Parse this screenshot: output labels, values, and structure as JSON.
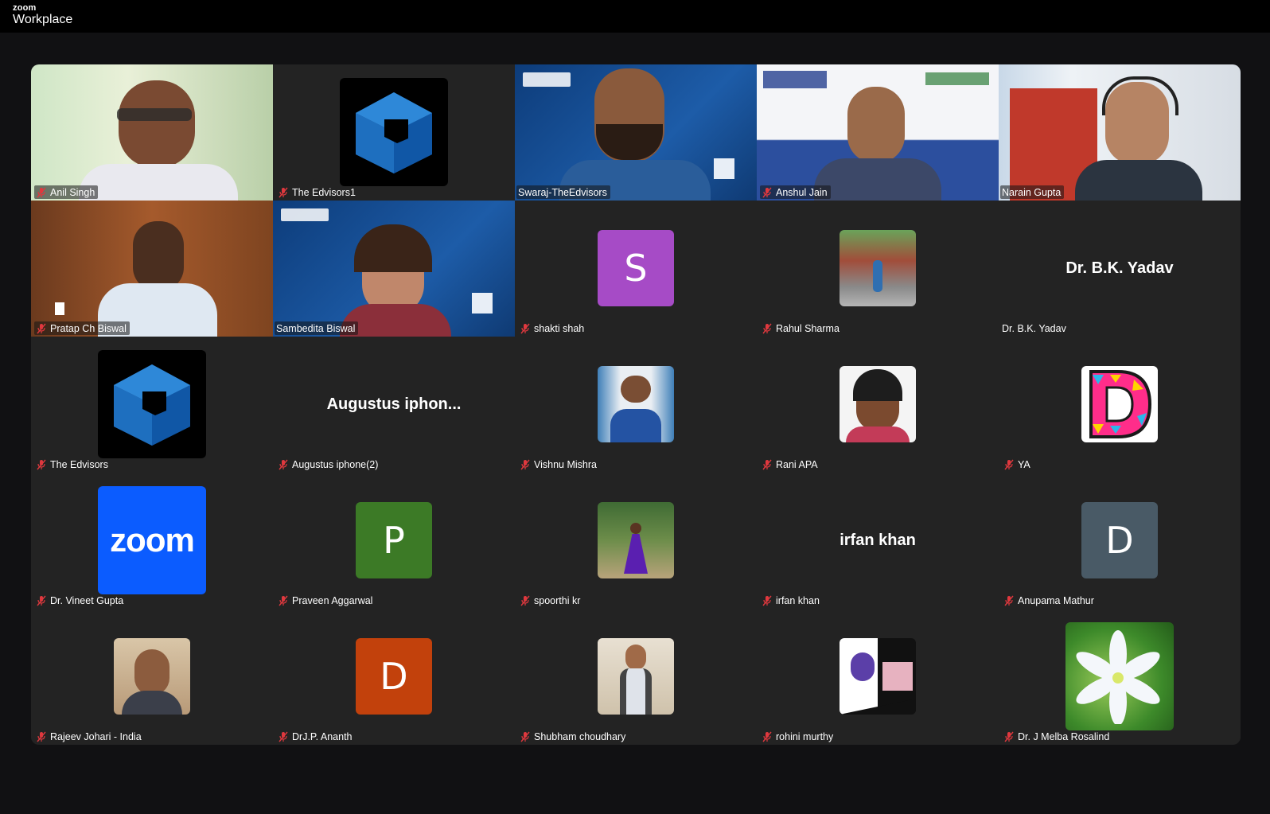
{
  "app": {
    "brand_small": "zoom",
    "brand_name": "Workplace"
  },
  "colors": {
    "active_speaker": "#35d39a",
    "muted_icon": "#e0383e"
  },
  "participants": [
    {
      "name": "Anil Singh",
      "muted": true,
      "kind": "video"
    },
    {
      "name": "The Edvisors1",
      "muted": true,
      "kind": "logo"
    },
    {
      "name": "Swaraj-TheEdvisors",
      "muted": false,
      "kind": "video",
      "active_speaker": true
    },
    {
      "name": "Anshul Jain",
      "muted": true,
      "kind": "video"
    },
    {
      "name": "Narain Gupta",
      "muted": false,
      "kind": "video"
    },
    {
      "name": "Pratap Ch Biswal",
      "muted": true,
      "kind": "video"
    },
    {
      "name": "Sambedita Biswal",
      "muted": false,
      "kind": "video"
    },
    {
      "name": "shakti shah",
      "muted": true,
      "kind": "initial",
      "initial": "S",
      "color": "#a64bc6"
    },
    {
      "name": "Rahul Sharma",
      "muted": true,
      "kind": "photo"
    },
    {
      "name": "Dr. B.K. Yadav",
      "muted": false,
      "kind": "name",
      "display_name": "Dr. B.K. Yadav"
    },
    {
      "name": "The Edvisors",
      "muted": true,
      "kind": "logo"
    },
    {
      "name": "Augustus iphone(2)",
      "muted": true,
      "kind": "name",
      "display_name": "Augustus  iphon..."
    },
    {
      "name": "Vishnu Mishra",
      "muted": true,
      "kind": "photo"
    },
    {
      "name": "Rani APA",
      "muted": true,
      "kind": "photo"
    },
    {
      "name": "YA",
      "muted": true,
      "kind": "photo-d"
    },
    {
      "name": "Dr. Vineet Gupta",
      "muted": true,
      "kind": "zoom-logo",
      "logo_text": "zoom"
    },
    {
      "name": "Praveen Aggarwal",
      "muted": true,
      "kind": "initial",
      "initial": "P",
      "color": "#3c7a26"
    },
    {
      "name": "spoorthi kr",
      "muted": true,
      "kind": "photo"
    },
    {
      "name": "irfan khan",
      "muted": true,
      "kind": "name",
      "display_name": "irfan khan"
    },
    {
      "name": "Anupama Mathur",
      "muted": true,
      "kind": "initial",
      "initial": "D",
      "color": "#495a66"
    },
    {
      "name": "Rajeev Johari - India",
      "muted": true,
      "kind": "photo"
    },
    {
      "name": "DrJ.P. Ananth",
      "muted": true,
      "kind": "initial",
      "initial": "D",
      "color": "#c2410c"
    },
    {
      "name": "Shubham choudhary",
      "muted": true,
      "kind": "photo"
    },
    {
      "name": "rohini murthy",
      "muted": true,
      "kind": "photo"
    },
    {
      "name": "Dr. J Melba Rosalind",
      "muted": true,
      "kind": "photo-flower"
    }
  ]
}
